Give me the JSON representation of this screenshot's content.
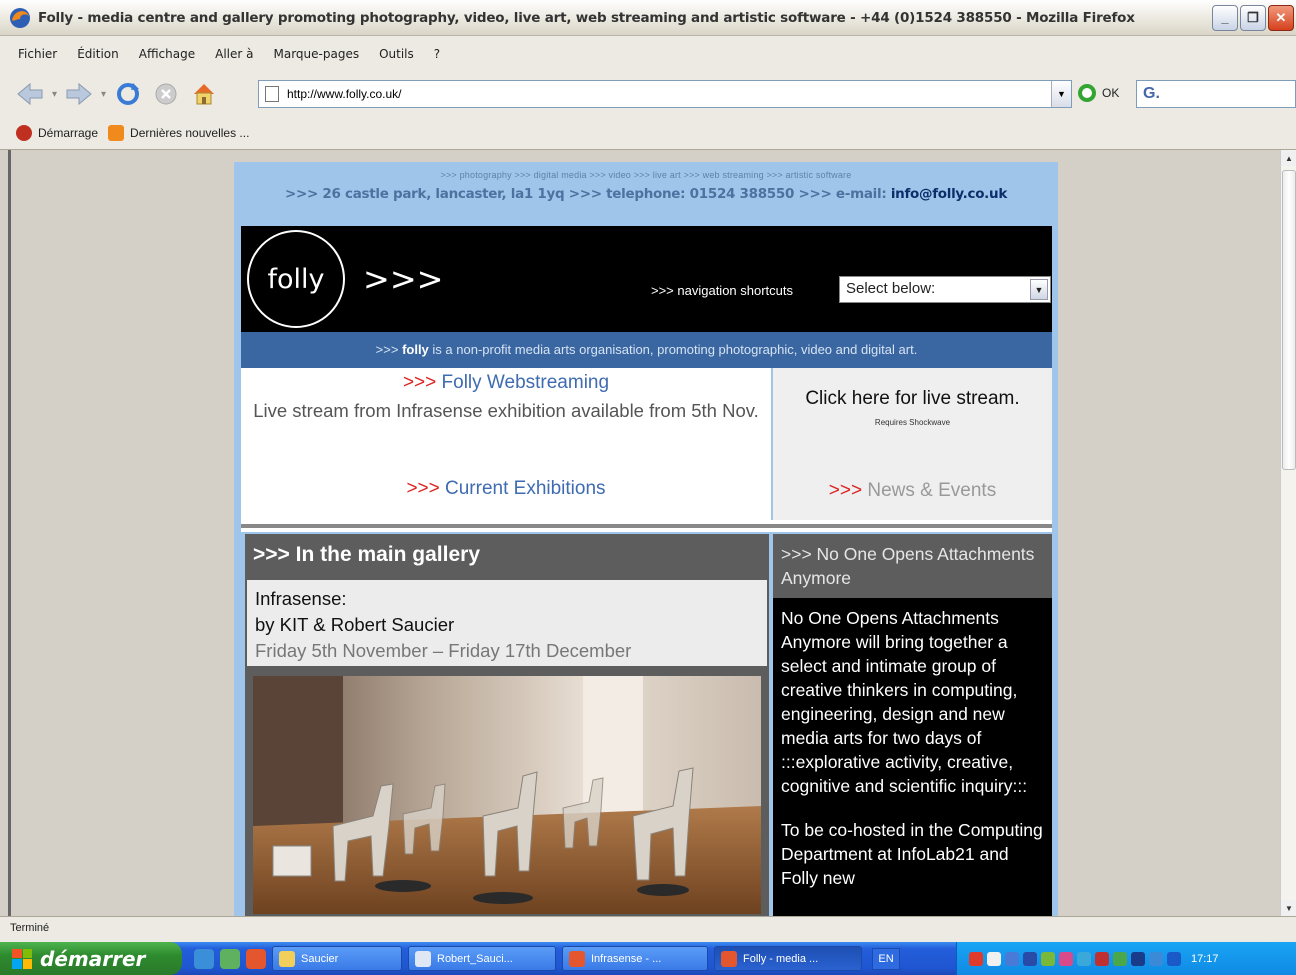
{
  "window": {
    "title": "Folly - media centre and gallery promoting photography, video, live art, web streaming and artistic software - +44 (0)1524 388550 - Mozilla Firefox",
    "minimize": "_",
    "maximize": "❐",
    "close": "✕"
  },
  "menu": [
    "Fichier",
    "Édition",
    "Affichage",
    "Aller à",
    "Marque-pages",
    "Outils",
    "?"
  ],
  "navbar": {
    "url": "http://www.folly.co.uk/",
    "ok_label": "OK",
    "search_glyph": "G."
  },
  "bookmarks": [
    "Démarrage",
    "Dernières nouvelles ..."
  ],
  "page": {
    "tagline": ">>> photography >>> digital media >>> video >>> live art >>> web streaming >>> artistic software",
    "address": ">>> 26 castle park, lancaster, la1 1yq >>> telephone: 01524 388550 >>> e-mail: ",
    "email": "info@folly.co.uk",
    "logo_text": "folly",
    "logo_arrows": ">>>",
    "nav_shortcuts_label": ">>> navigation shortcuts",
    "nav_select_value": "Select below:",
    "intro_prefix": ">>> ",
    "intro_bold": "folly",
    "intro_rest": " is a non-profit media arts organisation, promoting photographic, video and digital art.",
    "arrow": ">>>",
    "webstreaming_title": "Folly Webstreaming",
    "webstreaming_text": "Live stream from Infrasense exhibition available from 5th Nov.",
    "current_exhibitions": "Current Exhibitions",
    "live_stream": "Click here for live stream.",
    "live_stream_sub": "Requires Shockwave",
    "news_events": "News & Events",
    "gallery_heading": ">>> In the main gallery",
    "gallery_title_1": "Infrasense:",
    "gallery_title_2": "by KIT & Robert Saucier",
    "gallery_dates": "Friday 5th November – Friday 17th December",
    "side_heading": ">>> No One Opens Attachments Anymore",
    "side_p1": "No One Opens Attachments Anymore will bring together a select and intimate group of creative thinkers in computing, engineering, design and new media arts for two days of :::explorative activity, creative, cognitive and scientific inquiry:::",
    "side_p2": "To be co-hosted in the Computing Department at InfoLab21 and Folly new"
  },
  "status": "Terminé",
  "taskbar": {
    "start": "démarrer",
    "tasks": [
      "Saucier",
      "Robert_Sauci...",
      "Infrasense - ...",
      "Folly - media ..."
    ],
    "lang": "EN",
    "clock": "17:17"
  },
  "colors": {
    "page_bg": "#9fc6ea",
    "intro_band": "#3a67a2",
    "link_blue": "#3f6bb0",
    "arrow_red": "#dd2222"
  }
}
